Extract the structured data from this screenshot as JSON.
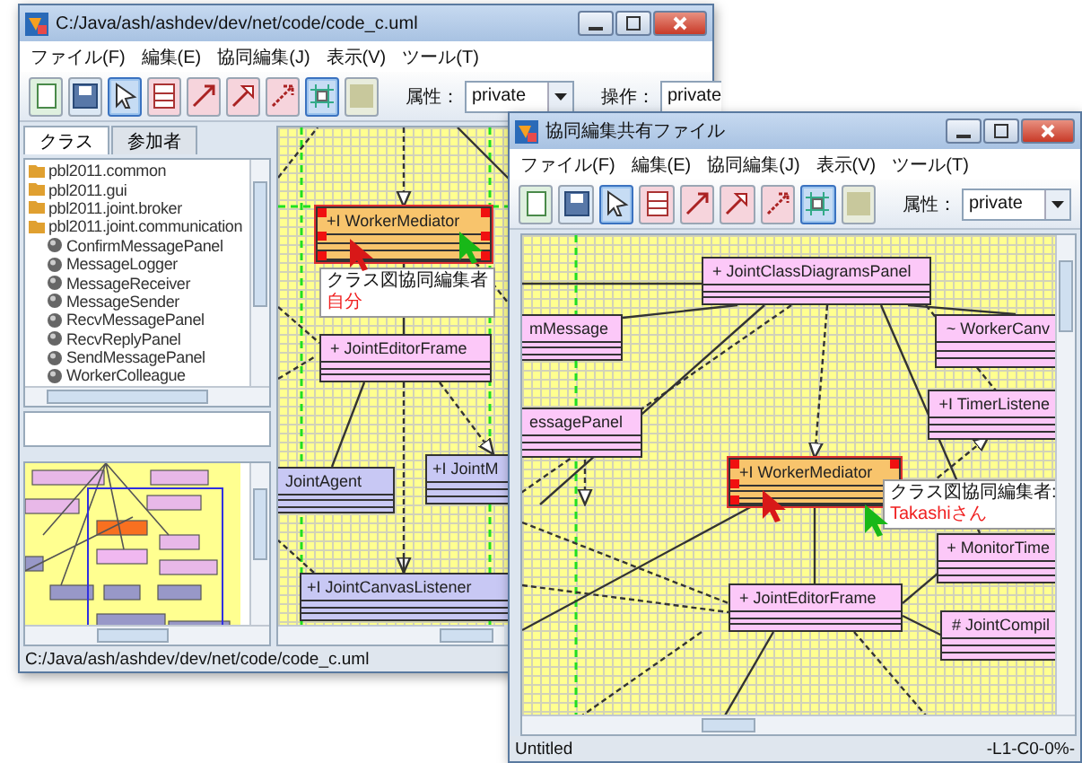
{
  "windows": [
    {
      "title": "C:/Java/ash/ashdev/dev/net/code/code_c.uml",
      "menu": [
        "ファイル(F)",
        "編集(E)",
        "協同編集(J)",
        "表示(V)",
        "ツール(T)"
      ],
      "toolbar": [
        {
          "kind": "new",
          "selected": false
        },
        {
          "kind": "save",
          "selected": false
        },
        {
          "kind": "select",
          "selected": true
        },
        {
          "kind": "class",
          "selected": false
        },
        {
          "kind": "association",
          "selected": false
        },
        {
          "kind": "generalization",
          "selected": false
        },
        {
          "kind": "dependency",
          "selected": false
        },
        {
          "kind": "grid",
          "selected": true
        },
        {
          "kind": "color",
          "selected": false
        }
      ],
      "fields": [
        {
          "label": "属性：",
          "value": "private",
          "kind": "dropdown"
        },
        {
          "label": "操作：",
          "value": "private",
          "kind": "text"
        }
      ],
      "side_tabs": [
        {
          "label": "クラス",
          "selected": true
        },
        {
          "label": "参加者",
          "selected": false
        }
      ],
      "tree": [
        {
          "label": "pbl2011.common",
          "kind": "package"
        },
        {
          "label": "pbl2011.gui",
          "kind": "package"
        },
        {
          "label": "pbl2011.joint.broker",
          "kind": "package"
        },
        {
          "label": "pbl2011.joint.communication",
          "kind": "package",
          "children": [
            {
              "label": "ConfirmMessagePanel",
              "kind": "class"
            },
            {
              "label": "MessageLogger",
              "kind": "class"
            },
            {
              "label": "MessageReceiver",
              "kind": "class"
            },
            {
              "label": "MessageSender",
              "kind": "class"
            },
            {
              "label": "RecvMessagePanel",
              "kind": "class"
            },
            {
              "label": "RecvReplyPanel",
              "kind": "class"
            },
            {
              "label": "SendMessagePanel",
              "kind": "class"
            },
            {
              "label": "WorkerColleague",
              "kind": "class"
            }
          ]
        }
      ],
      "classes": [
        {
          "name": "+I WorkerMediator",
          "color": "#f8c46c",
          "selected": true
        },
        {
          "name": "+ JointEditorFrame",
          "color": "#fcc8f8",
          "selected": false
        },
        {
          "name": "JointAgent",
          "color": "#c8c8f4",
          "selected": false
        },
        {
          "name": "+I JointM",
          "color": "#c8c8f4",
          "selected": false
        },
        {
          "name": "+I JointCanvasListener",
          "color": "#c8c8f4",
          "selected": false
        }
      ],
      "tooltip": {
        "label": "クラス図協同編集者",
        "user": "自分"
      },
      "cursors": [
        {
          "color": "#d81818"
        },
        {
          "color": "#18b818"
        }
      ],
      "status_left": "C:/Java/ash/ashdev/dev/net/code/code_c.uml"
    },
    {
      "title": "協同編集共有ファイル",
      "menu": [
        "ファイル(F)",
        "編集(E)",
        "協同編集(J)",
        "表示(V)",
        "ツール(T)"
      ],
      "toolbar": [
        {
          "kind": "new",
          "selected": false
        },
        {
          "kind": "save",
          "selected": false
        },
        {
          "kind": "select",
          "selected": true
        },
        {
          "kind": "class",
          "selected": false
        },
        {
          "kind": "association",
          "selected": false
        },
        {
          "kind": "generalization",
          "selected": false
        },
        {
          "kind": "dependency",
          "selected": false
        },
        {
          "kind": "grid",
          "selected": true
        },
        {
          "kind": "color",
          "selected": false
        }
      ],
      "fields": [
        {
          "label": "属性：",
          "value": "private",
          "kind": "dropdown"
        }
      ],
      "classes": [
        {
          "name": "mMessage",
          "color": "#fcc8f8",
          "selected": false
        },
        {
          "name": "+ JointClassDiagramsPanel",
          "color": "#fcc8f8",
          "selected": false
        },
        {
          "name": "~ WorkerCanv",
          "color": "#fcc8f8",
          "selected": false
        },
        {
          "name": "essagePanel",
          "color": "#fcc8f8",
          "selected": false
        },
        {
          "name": "+I TimerListene",
          "color": "#fcc8f8",
          "selected": false
        },
        {
          "name": "+I WorkerMediator",
          "color": "#f8c46c",
          "selected": true
        },
        {
          "name": "+ MonitorTime",
          "color": "#fcc8f8",
          "selected": false
        },
        {
          "name": "+ JointEditorFrame",
          "color": "#fcc8f8",
          "selected": false
        },
        {
          "name": "# JointCompil",
          "color": "#fcc8f8",
          "selected": false
        }
      ],
      "tooltip": {
        "label": "クラス図協同編集者:",
        "user": "Takashiさん"
      },
      "cursors": [
        {
          "color": "#d81818"
        },
        {
          "color": "#18b818"
        }
      ],
      "status_left": "Untitled",
      "status_right": "-L1-C0-0%-"
    }
  ]
}
